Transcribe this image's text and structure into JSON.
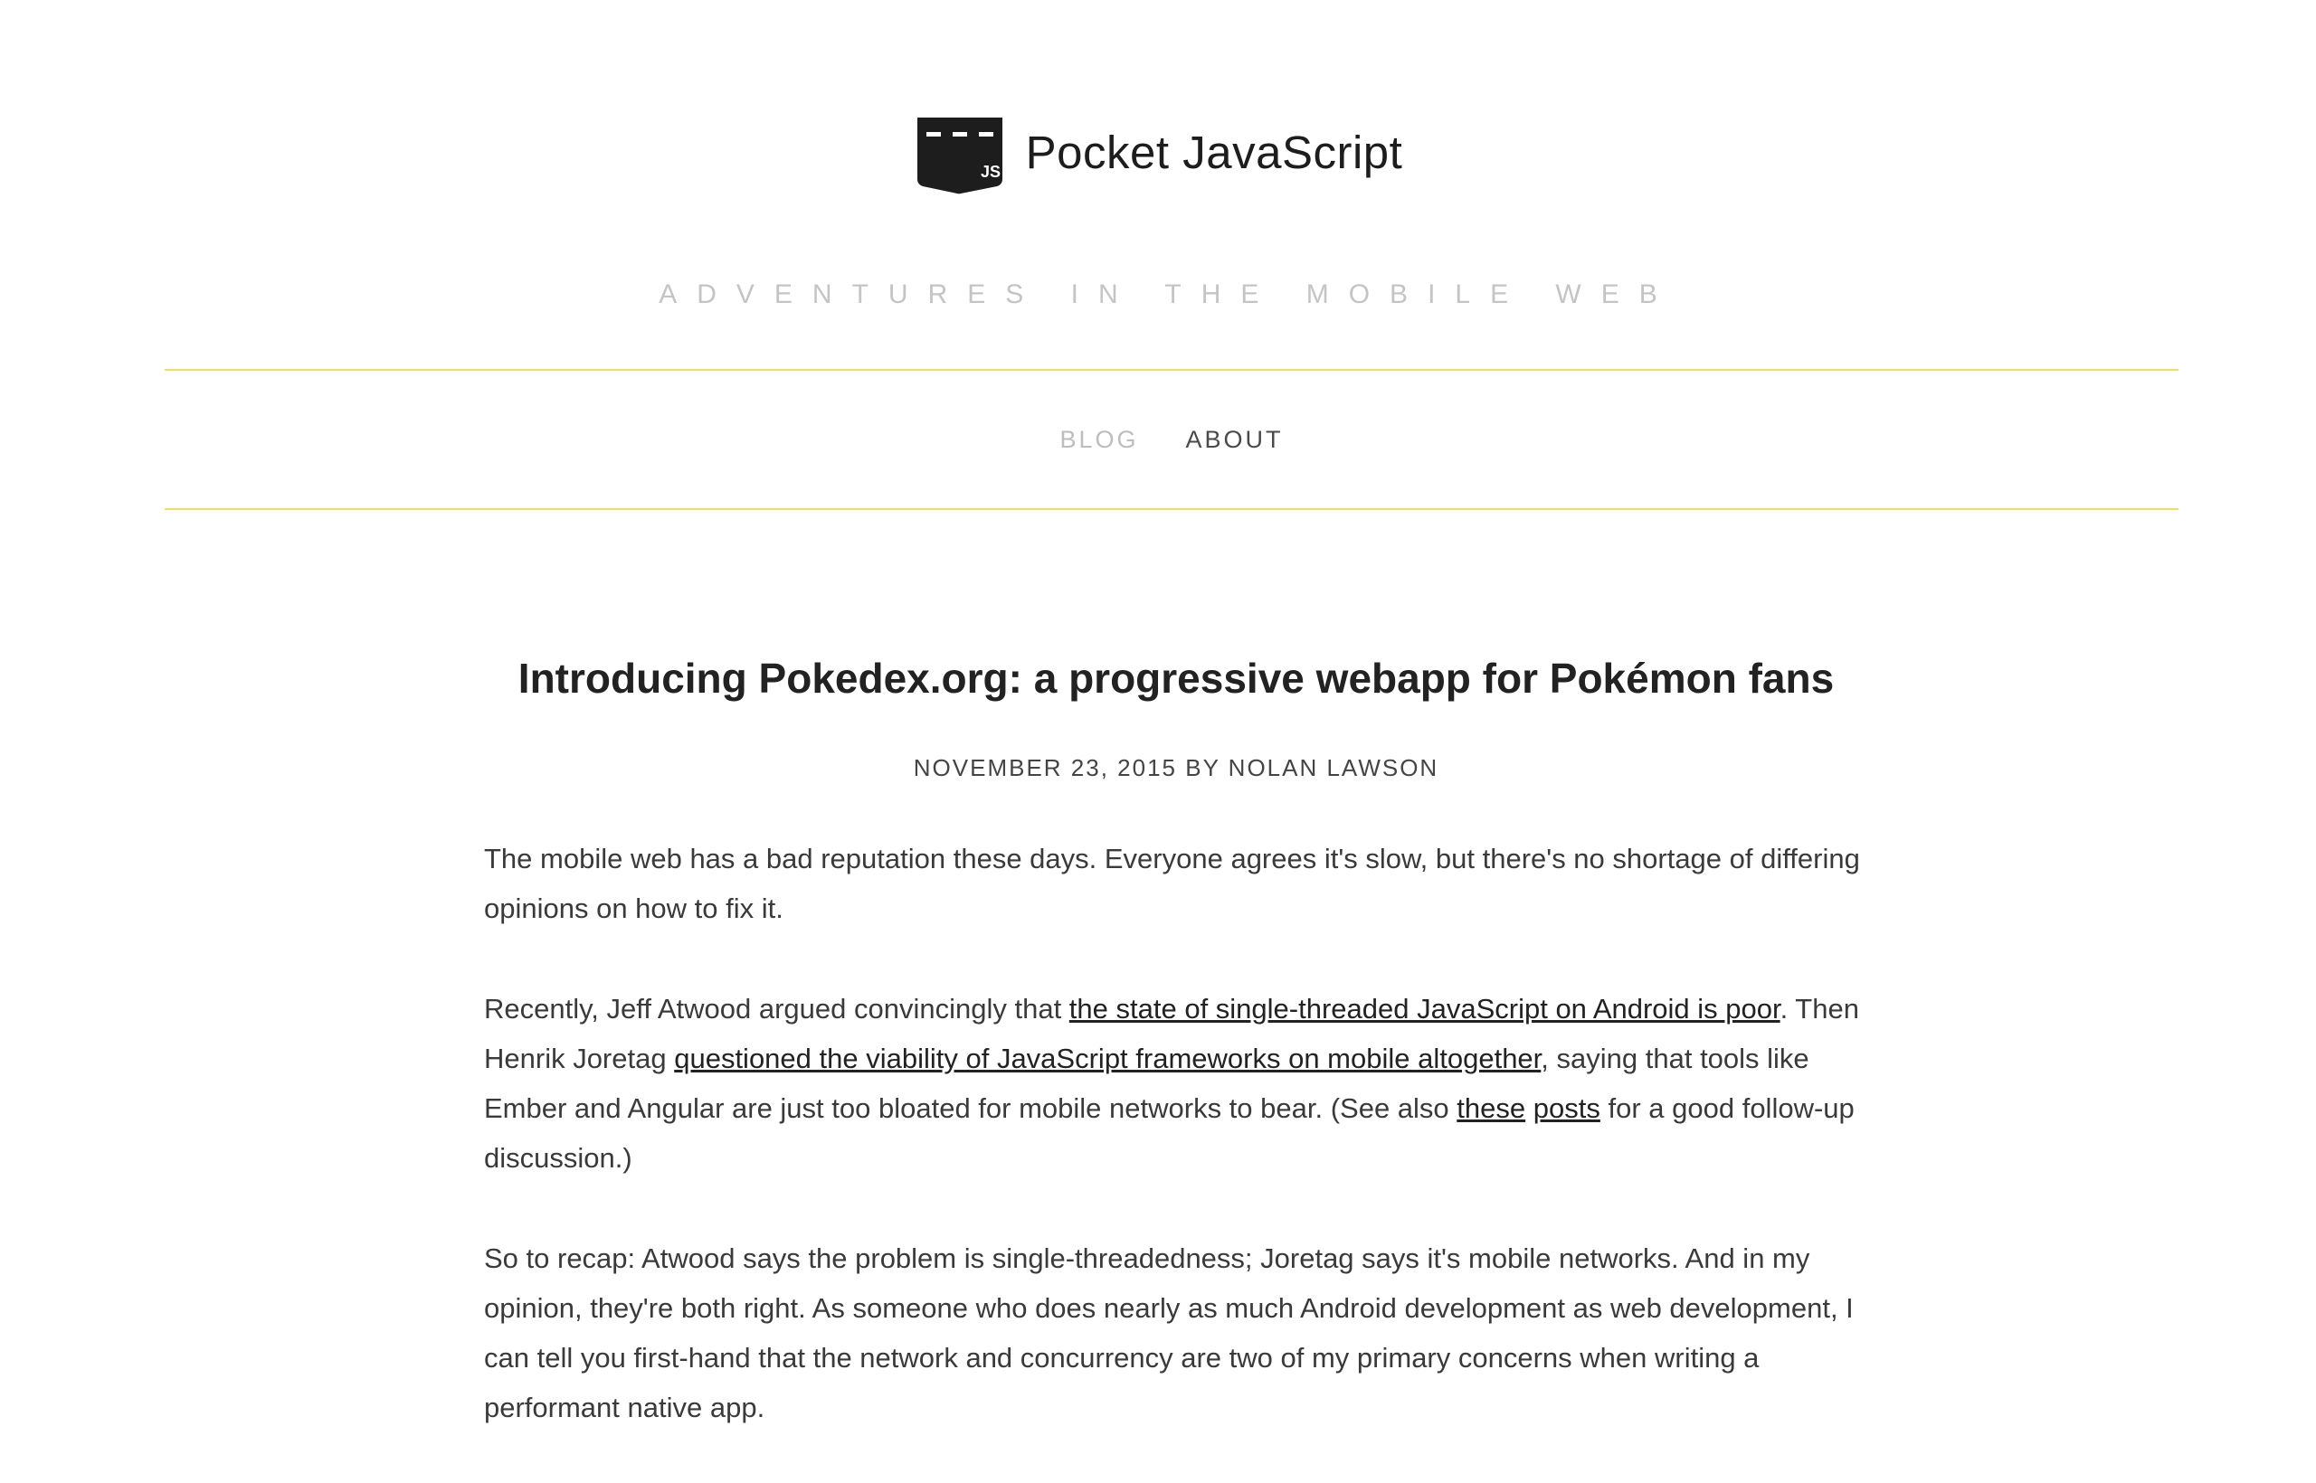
{
  "site": {
    "logo_icon": "pocket-js-icon",
    "logo_badge": "JS",
    "title": "Pocket JavaScript",
    "tagline": "ADVENTURES IN THE MOBILE WEB",
    "accent_color": "#f3de5f"
  },
  "nav": {
    "items": [
      {
        "label": "BLOG"
      },
      {
        "label": "ABOUT"
      }
    ]
  },
  "post": {
    "title": "Introducing Pokedex.org: a progressive webapp for Pokémon fans",
    "meta": "NOVEMBER 23, 2015 BY NOLAN LAWSON",
    "p1": "The mobile web has a bad reputation these days. Everyone agrees it's slow, but there's no shortage of differing opinions on how to fix it.",
    "p2": {
      "t1": "Recently, Jeff Atwood argued convincingly that ",
      "link1": "the state of single-threaded JavaScript on Android is poor",
      "t2": ". Then Henrik Joretag ",
      "link2": "questioned the viability of JavaScript frameworks on mobile altogether",
      "t3": ", saying that tools like Ember and Angular are just too bloated for mobile networks to bear. (See also ",
      "link3": "these",
      "t4": " ",
      "link4": "posts",
      "t5": " for a good follow-up discussion.)"
    },
    "p3": "So to recap: Atwood says the problem is single-threadedness; Joretag says it's mobile networks. And in my opinion, they're both right. As someone who does nearly as much Android development as web development, I can tell you first-hand that the network and concurrency are two of my primary concerns when writing a performant native app."
  }
}
